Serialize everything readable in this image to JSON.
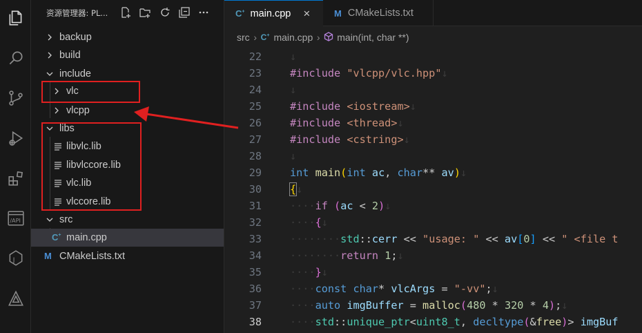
{
  "activity_bar": {
    "items": [
      "explorer-icon",
      "search-icon",
      "source-control-icon",
      "run-debug-icon",
      "extensions-icon",
      "api-icon",
      "java-icon",
      "triangle-ruler-icon"
    ]
  },
  "sidebar": {
    "title": "资源管理器: PL...",
    "tools": [
      "new-file-icon",
      "new-folder-icon",
      "refresh-icon",
      "collapse-all-icon",
      "more-icon"
    ],
    "tree": [
      {
        "label": "backup",
        "type": "folder",
        "expanded": false,
        "depth": 0
      },
      {
        "label": "build",
        "type": "folder",
        "expanded": false,
        "depth": 0
      },
      {
        "label": "include",
        "type": "folder",
        "expanded": true,
        "depth": 0
      },
      {
        "label": "vlc",
        "type": "folder",
        "expanded": false,
        "depth": 1
      },
      {
        "label": "vlcpp",
        "type": "folder",
        "expanded": false,
        "depth": 1
      },
      {
        "label": "libs",
        "type": "folder",
        "expanded": true,
        "depth": 0
      },
      {
        "label": "libvlc.lib",
        "type": "file",
        "depth": 1
      },
      {
        "label": "libvlccore.lib",
        "type": "file",
        "depth": 1
      },
      {
        "label": "vlc.lib",
        "type": "file",
        "depth": 1
      },
      {
        "label": "vlccore.lib",
        "type": "file",
        "depth": 1
      },
      {
        "label": "src",
        "type": "folder",
        "expanded": true,
        "depth": 0
      },
      {
        "label": "main.cpp",
        "type": "cpp",
        "depth": 1,
        "selected": true
      },
      {
        "label": "CMakeLists.txt",
        "type": "cmake",
        "depth": 0
      }
    ]
  },
  "tabs": [
    {
      "label": "main.cpp",
      "active": true,
      "icon": "cpp-file-icon",
      "close": "×"
    },
    {
      "label": "CMakeLists.txt",
      "active": false,
      "icon": "cmake-file-icon"
    }
  ],
  "breadcrumb": {
    "items": [
      "src",
      "main.cpp",
      "main(int, char **)"
    ]
  },
  "code": {
    "current_line": 38,
    "lines": [
      {
        "n": "22",
        "text": ""
      },
      {
        "n": "23",
        "text": "#include \"vlcpp/vlc.hpp\""
      },
      {
        "n": "24",
        "text": ""
      },
      {
        "n": "25",
        "text": "#include <iostream>"
      },
      {
        "n": "26",
        "text": "#include <thread>"
      },
      {
        "n": "27",
        "text": "#include <cstring>"
      },
      {
        "n": "28",
        "text": ""
      },
      {
        "n": "29",
        "text": "int main(int ac, char** av)"
      },
      {
        "n": "30",
        "text": "{"
      },
      {
        "n": "31",
        "text": "if (ac < 2)"
      },
      {
        "n": "32",
        "text": "{"
      },
      {
        "n": "33",
        "text": "std::cerr << \"usage: \" << av[0] << \" <file t"
      },
      {
        "n": "34",
        "text": "return 1;"
      },
      {
        "n": "35",
        "text": "}"
      },
      {
        "n": "36",
        "text": "const char* vlcArgs = \"-vv\";"
      },
      {
        "n": "37",
        "text": "auto imgBuffer = malloc(480 * 320 * 4);"
      },
      {
        "n": "38",
        "text": "std::unique_ptr<uint8_t, decltype(&free)> imgBuf"
      }
    ]
  },
  "colors": {
    "accent": "#0078d4",
    "annotation": "#e02020",
    "selection": "#37373d",
    "background": "#1f1f1f"
  }
}
